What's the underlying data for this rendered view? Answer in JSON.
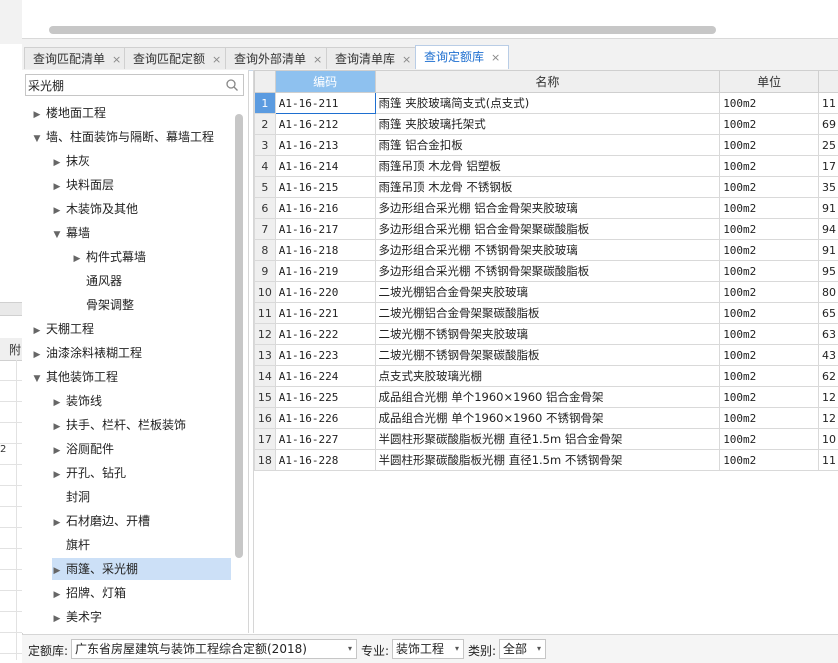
{
  "tabs": [
    {
      "label": "查询匹配清单",
      "close": "×"
    },
    {
      "label": "查询匹配定额",
      "close": "×"
    },
    {
      "label": "查询外部清单",
      "close": "×"
    },
    {
      "label": "查询清单库",
      "close": "×"
    },
    {
      "label": "查询定额库",
      "close": "×",
      "active": true
    }
  ],
  "left_sliver": {
    "col_label": "附",
    "stray": "2"
  },
  "search": {
    "value": "采光棚"
  },
  "tree": [
    {
      "label": "楼地面工程",
      "level": 0,
      "arrow": "▶"
    },
    {
      "label": "墙、柱面装饰与隔断、幕墙工程",
      "level": 0,
      "arrow": "▼"
    },
    {
      "label": "抹灰",
      "level": 1,
      "arrow": "▶"
    },
    {
      "label": "块料面层",
      "level": 1,
      "arrow": "▶"
    },
    {
      "label": "木装饰及其他",
      "level": 1,
      "arrow": "▶"
    },
    {
      "label": "幕墙",
      "level": 1,
      "arrow": "▼"
    },
    {
      "label": "构件式幕墙",
      "level": 2,
      "arrow": "▶"
    },
    {
      "label": "通风器",
      "level": 2,
      "arrow": ""
    },
    {
      "label": "骨架调整",
      "level": 2,
      "arrow": ""
    },
    {
      "label": "天棚工程",
      "level": 0,
      "arrow": "▶"
    },
    {
      "label": "油漆涂料裱糊工程",
      "level": 0,
      "arrow": "▶"
    },
    {
      "label": "其他装饰工程",
      "level": 0,
      "arrow": "▼"
    },
    {
      "label": "装饰线",
      "level": 1,
      "arrow": "▶"
    },
    {
      "label": "扶手、栏杆、栏板装饰",
      "level": 1,
      "arrow": "▶"
    },
    {
      "label": "浴厕配件",
      "level": 1,
      "arrow": "▶"
    },
    {
      "label": "开孔、钻孔",
      "level": 1,
      "arrow": "▶"
    },
    {
      "label": "封洞",
      "level": 1,
      "arrow": ""
    },
    {
      "label": "石材磨边、开槽",
      "level": 1,
      "arrow": "▶"
    },
    {
      "label": "旗杆",
      "level": 1,
      "arrow": ""
    },
    {
      "label": "雨篷、采光棚",
      "level": 1,
      "arrow": "▶",
      "selected": true
    },
    {
      "label": "招牌、灯箱",
      "level": 1,
      "arrow": "▶"
    },
    {
      "label": "美术字",
      "level": 1,
      "arrow": "▶"
    }
  ],
  "grid": {
    "headers": {
      "code": "编码",
      "name": "名称",
      "unit": "单位"
    },
    "rows": [
      {
        "n": "1",
        "code": "A1-16-211",
        "name": "雨篷 夹胶玻璃简支式(点支式)",
        "unit": "100m2",
        "extra": "11"
      },
      {
        "n": "2",
        "code": "A1-16-212",
        "name": "雨篷 夹胶玻璃托架式",
        "unit": "100m2",
        "extra": "69"
      },
      {
        "n": "3",
        "code": "A1-16-213",
        "name": "雨篷 铝合金扣板",
        "unit": "100m2",
        "extra": "25"
      },
      {
        "n": "4",
        "code": "A1-16-214",
        "name": "雨篷吊顶 木龙骨 铝塑板",
        "unit": "100m2",
        "extra": "17"
      },
      {
        "n": "5",
        "code": "A1-16-215",
        "name": "雨篷吊顶 木龙骨 不锈钢板",
        "unit": "100m2",
        "extra": "35"
      },
      {
        "n": "6",
        "code": "A1-16-216",
        "name": "多边形组合采光棚 铝合金骨架夹胶玻璃",
        "unit": "100m2",
        "extra": "91"
      },
      {
        "n": "7",
        "code": "A1-16-217",
        "name": "多边形组合采光棚 铝合金骨架聚碳酸脂板",
        "unit": "100m2",
        "extra": "94"
      },
      {
        "n": "8",
        "code": "A1-16-218",
        "name": "多边形组合采光棚 不锈钢骨架夹胶玻璃",
        "unit": "100m2",
        "extra": "91"
      },
      {
        "n": "9",
        "code": "A1-16-219",
        "name": "多边形组合采光棚 不锈钢骨架聚碳酸脂板",
        "unit": "100m2",
        "extra": "95"
      },
      {
        "n": "10",
        "code": "A1-16-220",
        "name": "二坡光棚铝合金骨架夹胶玻璃",
        "unit": "100m2",
        "extra": "80"
      },
      {
        "n": "11",
        "code": "A1-16-221",
        "name": "二坡光棚铝合金骨架聚碳酸脂板",
        "unit": "100m2",
        "extra": "65"
      },
      {
        "n": "12",
        "code": "A1-16-222",
        "name": "二坡光棚不锈钢骨架夹胶玻璃",
        "unit": "100m2",
        "extra": "63"
      },
      {
        "n": "13",
        "code": "A1-16-223",
        "name": "二坡光棚不锈钢骨架聚碳酸脂板",
        "unit": "100m2",
        "extra": "43"
      },
      {
        "n": "14",
        "code": "A1-16-224",
        "name": "点支式夹胶玻璃光棚",
        "unit": "100m2",
        "extra": "62"
      },
      {
        "n": "15",
        "code": "A1-16-225",
        "name": "成品组合光棚 单个1960×1960 铝合金骨架",
        "unit": "100m2",
        "extra": "12"
      },
      {
        "n": "16",
        "code": "A1-16-226",
        "name": "成品组合光棚 单个1960×1960 不锈钢骨架",
        "unit": "100m2",
        "extra": "12"
      },
      {
        "n": "17",
        "code": "A1-16-227",
        "name": "半圆柱形聚碳酸脂板光棚 直径1.5m 铝合金骨架",
        "unit": "100m2",
        "extra": "10"
      },
      {
        "n": "18",
        "code": "A1-16-228",
        "name": "半圆柱形聚碳酸脂板光棚 直径1.5m 不锈钢骨架",
        "unit": "100m2",
        "extra": "11"
      }
    ]
  },
  "bottom": {
    "quota_label": "定额库:",
    "quota_value": "广东省房屋建筑与装饰工程综合定额(2018)",
    "major_label": "专业:",
    "major_value": "装饰工程",
    "category_label": "类别:",
    "category_value": "全部",
    "caret": "▾"
  },
  "colors": {
    "accent": "#1e6fd0",
    "header_code": "#8ec1ef",
    "selection": "#cce0f7"
  }
}
